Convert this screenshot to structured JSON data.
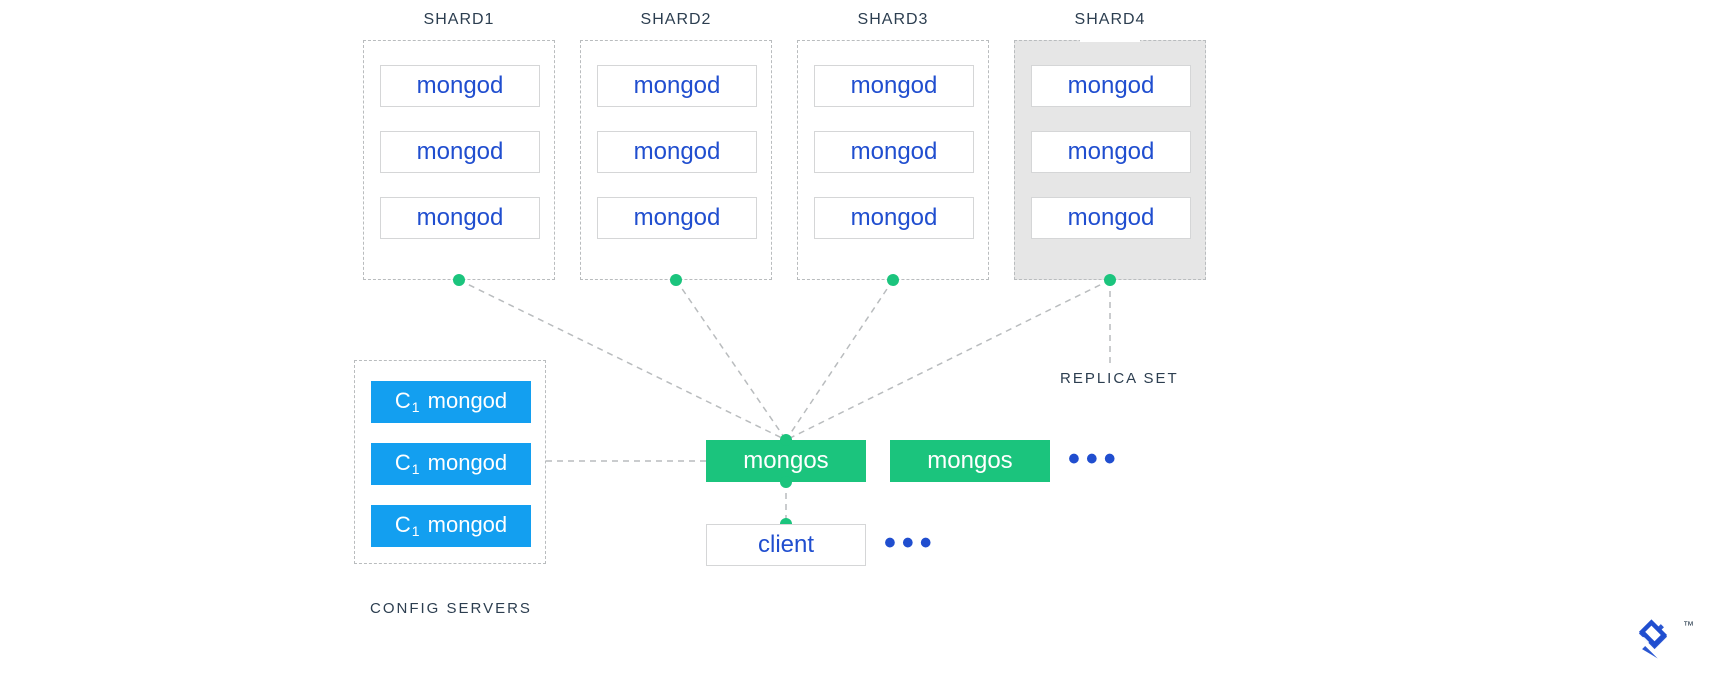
{
  "shards": [
    {
      "title": "SHARD1",
      "nodes": [
        "mongod",
        "mongod",
        "mongod"
      ]
    },
    {
      "title": "SHARD2",
      "nodes": [
        "mongod",
        "mongod",
        "mongod"
      ]
    },
    {
      "title": "SHARD3",
      "nodes": [
        "mongod",
        "mongod",
        "mongod"
      ]
    },
    {
      "title": "SHARD4",
      "nodes": [
        "mongod",
        "mongod",
        "mongod"
      ],
      "replicaSet": true
    }
  ],
  "replicaSetLabel": "REPLICA SET",
  "config": {
    "label": "CONFIG SERVERS",
    "nodes": [
      "C1 mongod",
      "C1 mongod",
      "C1 mongod"
    ]
  },
  "routers": [
    "mongos",
    "mongos"
  ],
  "client": "client",
  "ellipsis_glyph": "•••"
}
